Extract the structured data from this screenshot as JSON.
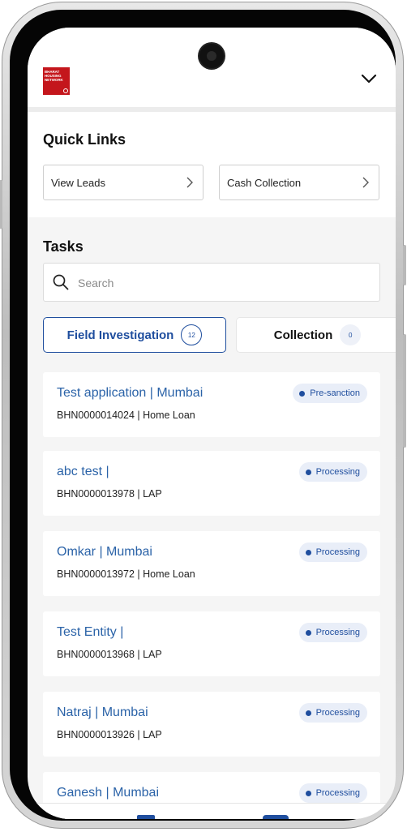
{
  "header": {
    "logo_lines": [
      "BHARAT",
      "HOUSING",
      "NETWORK"
    ],
    "chevron_icon": "chevron-down-icon"
  },
  "quick_links": {
    "title": "Quick Links",
    "items": [
      {
        "label": "View Leads",
        "icon": "chevron-right-icon"
      },
      {
        "label": "Cash Collection",
        "icon": "chevron-right-icon"
      }
    ]
  },
  "tasks": {
    "title": "Tasks",
    "search": {
      "placeholder": "Search",
      "icon": "search-icon"
    },
    "tabs": [
      {
        "label": "Field Investigation",
        "count": "12",
        "active": true
      },
      {
        "label": "Collection",
        "count": "0",
        "active": false
      }
    ],
    "items": [
      {
        "title": "Test application | Mumbai",
        "subtitle": "BHN0000014024 | Home Loan",
        "status": "Pre-sanction"
      },
      {
        "title": "abc test |",
        "subtitle": "BHN0000013978 | LAP",
        "status": "Processing"
      },
      {
        "title": "Omkar | Mumbai",
        "subtitle": "BHN0000013972 | Home Loan",
        "status": "Processing"
      },
      {
        "title": "Test Entity |",
        "subtitle": "BHN0000013968 | LAP",
        "status": "Processing"
      },
      {
        "title": "Natraj | Mumbai",
        "subtitle": "BHN0000013926 | LAP",
        "status": "Processing"
      },
      {
        "title": "Ganesh | Mumbai",
        "subtitle": "",
        "status": "Processing"
      }
    ]
  },
  "colors": {
    "brand_red": "#c4161c",
    "accent_blue": "#1f4e9e",
    "link_blue": "#2b63a8",
    "badge_bg": "#e9eef8"
  }
}
